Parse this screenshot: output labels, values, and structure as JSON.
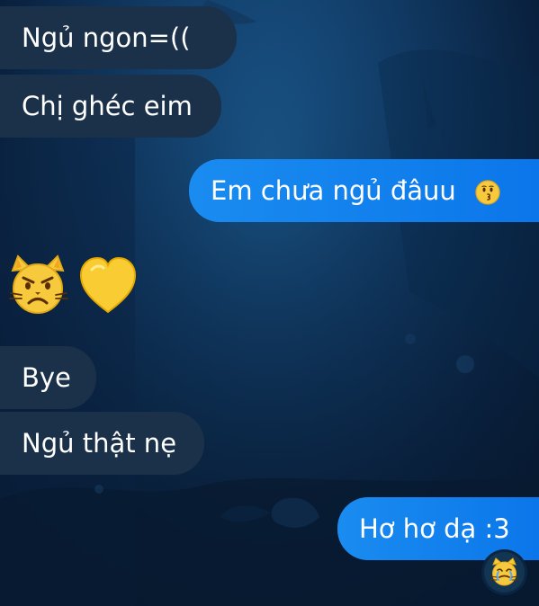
{
  "chat": {
    "messages": [
      {
        "id": "msg1",
        "direction": "incoming",
        "text": "Ngủ ngon=(("
      },
      {
        "id": "msg2",
        "direction": "incoming",
        "text": "Chị ghéc eim"
      },
      {
        "id": "msg3",
        "direction": "outgoing",
        "text": "Em chưa ngủ đâuu",
        "emoji": "kissing-face-icon"
      },
      {
        "id": "emoji-row",
        "direction": "incoming",
        "emojis": [
          "pouting-cat-face-icon",
          "yellow-heart-icon"
        ]
      },
      {
        "id": "msg4",
        "direction": "incoming",
        "text": "Bye"
      },
      {
        "id": "msg5",
        "direction": "incoming",
        "text": "Ngủ thật nẹ"
      },
      {
        "id": "msg6",
        "direction": "outgoing",
        "text": "Hơ hơ dạ :3",
        "reaction": "crying-cat-face-icon"
      }
    ]
  },
  "colors": {
    "background_top": "#1c5d93",
    "background_bottom": "#061427",
    "incoming_bubble": "#1b3149",
    "outgoing_bubble": "#0b76ea",
    "text": "#ffffff"
  }
}
